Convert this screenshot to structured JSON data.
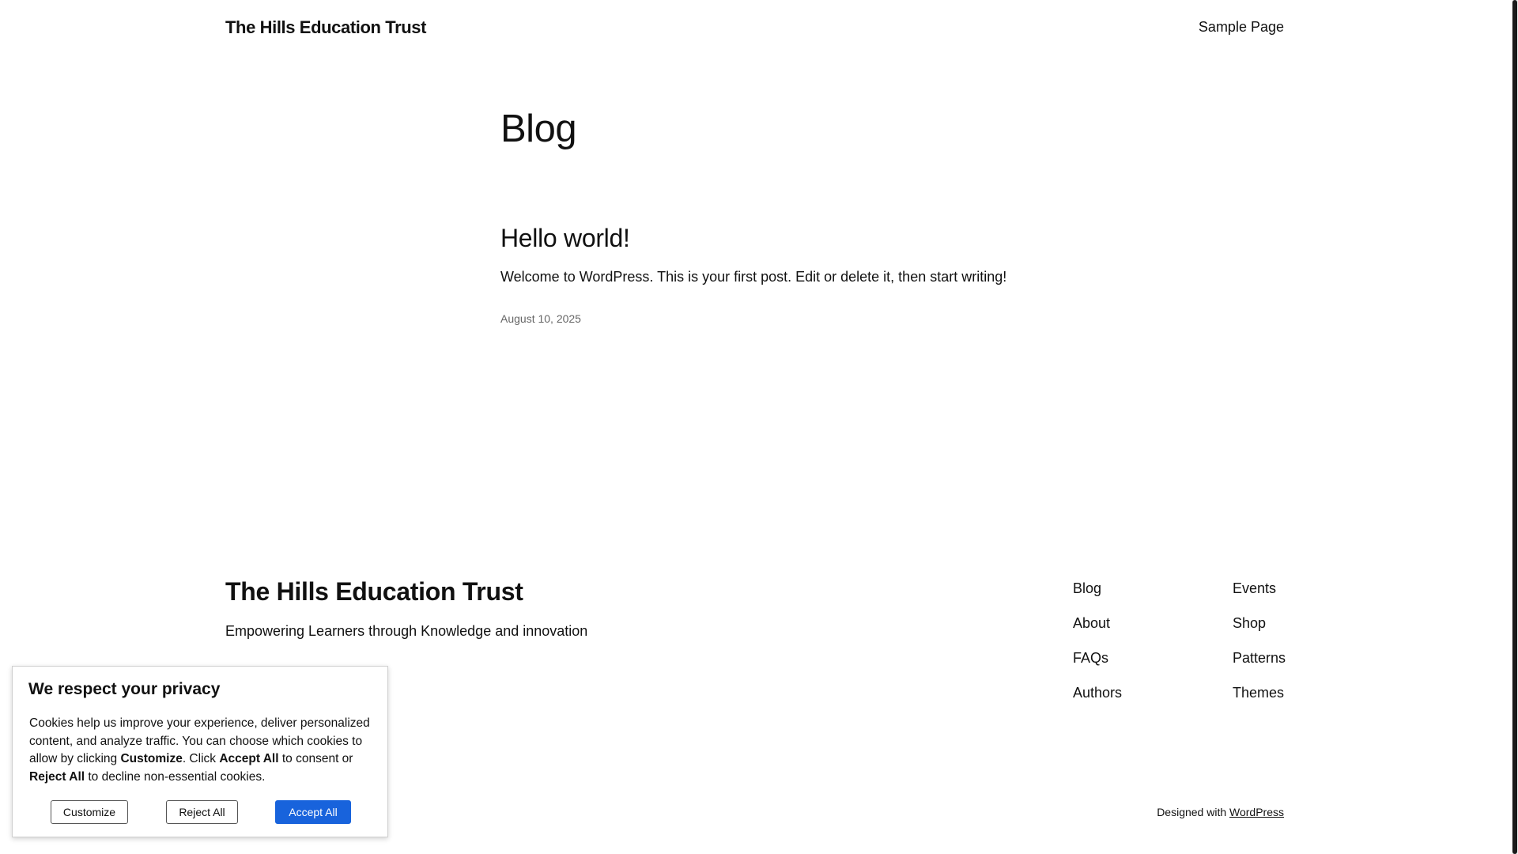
{
  "header": {
    "site_title": "The Hills Education Trust",
    "nav": {
      "sample_page": "Sample Page"
    }
  },
  "main": {
    "heading": "Blog",
    "posts": [
      {
        "title": "Hello world!",
        "excerpt": "Welcome to WordPress. This is your first post. Edit or delete it, then start writing!",
        "date": "August 10, 2025"
      }
    ]
  },
  "footer": {
    "title": "The Hills Education Trust",
    "tagline": "Empowering Learners through Knowledge and innovation",
    "nav_col1": [
      "Blog",
      "About",
      "FAQs",
      "Authors"
    ],
    "nav_col2": [
      "Events",
      "Shop",
      "Patterns",
      "Themes"
    ],
    "credit_prefix": "Designed with ",
    "credit_link": "WordPress"
  },
  "cookie_banner": {
    "title": "We respect your privacy",
    "text_1": "Cookies help us improve your experience, deliver personalized content, and analyze traffic. You can choose which cookies to allow by clicking ",
    "text_customize": "Customize",
    "text_2": ". Click ",
    "text_accept": "Accept All",
    "text_3": " to consent or ",
    "text_reject": "Reject All",
    "text_4": " to decline non-essential cookies.",
    "buttons": {
      "customize": "Customize",
      "reject": "Reject All",
      "accept": "Accept All"
    },
    "accent_color": "#1863dc"
  }
}
